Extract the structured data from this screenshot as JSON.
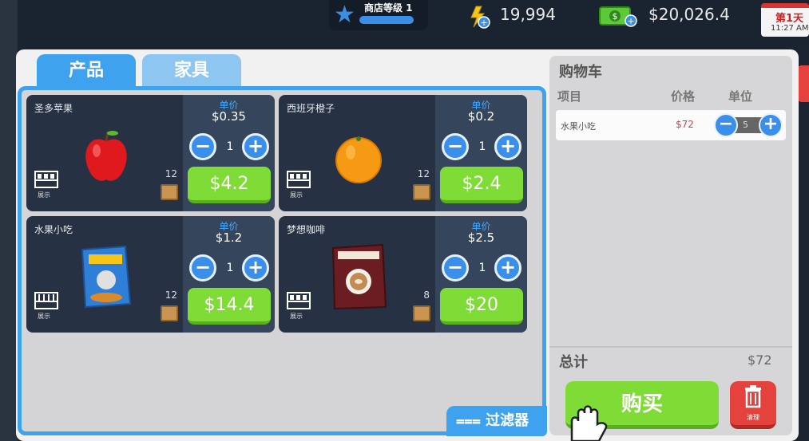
{
  "hud": {
    "store_level": "商店等级 1",
    "energy": "19,994",
    "cash": "$20,026.4",
    "day": "第1天",
    "time": "11:27 AM"
  },
  "tabs": [
    {
      "label": "产品"
    },
    {
      "label": "家具"
    }
  ],
  "products": [
    {
      "name": "圣多苹果",
      "unit_label": "单价",
      "unit_price": "$0.35",
      "quantity": "1",
      "stock": "12",
      "total": "$4.2",
      "shelf_label": "展示",
      "icon": "apple-icon"
    },
    {
      "name": "西班牙橙子",
      "unit_label": "单价",
      "unit_price": "$0.2",
      "quantity": "1",
      "stock": "12",
      "total": "$2.4",
      "shelf_label": "展示",
      "icon": "orange-icon"
    },
    {
      "name": "水果小吃",
      "unit_label": "单价",
      "unit_price": "$1.2",
      "quantity": "1",
      "stock": "12",
      "total": "$14.4",
      "shelf_label": "展示",
      "icon": "cereal-box-icon"
    },
    {
      "name": "梦想咖啡",
      "unit_label": "单价",
      "unit_price": "$2.5",
      "quantity": "1",
      "stock": "8",
      "total": "$20",
      "shelf_label": "展示",
      "icon": "coffee-bag-icon"
    }
  ],
  "filter_label": "过滤器",
  "cart": {
    "title": "购物车",
    "col_item": "项目",
    "col_price": "价格",
    "col_unit": "单位",
    "items": [
      {
        "name": "水果小吃",
        "price": "$72",
        "units": "5"
      }
    ],
    "total_label": "总计",
    "total_value": "$72",
    "buy_label": "购买",
    "clear_label": "清理"
  },
  "colors": {
    "accent": "#3ea2ee",
    "buy_green": "#7fdc36",
    "danger_red": "#e5413d",
    "card_bg": "#263243"
  }
}
